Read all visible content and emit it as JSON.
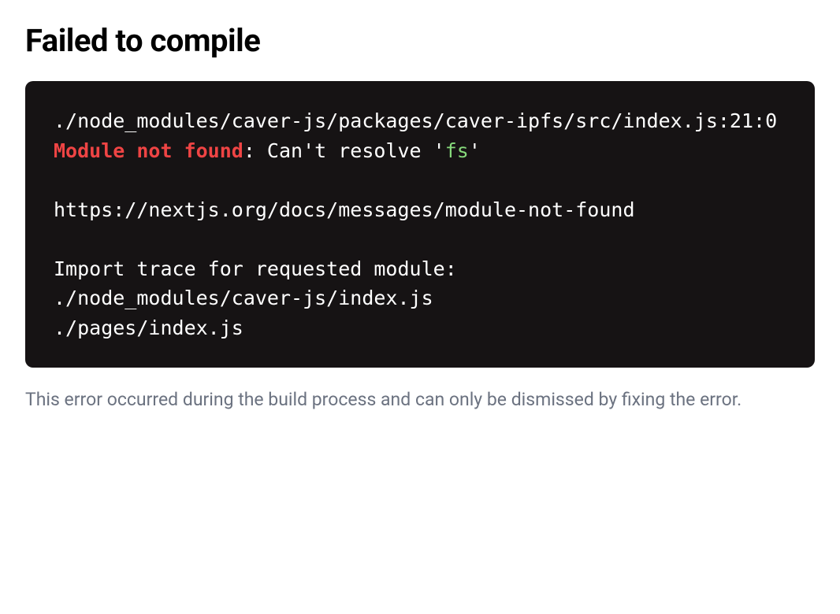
{
  "title": "Failed to compile",
  "code": {
    "file_location": "./node_modules/caver-js/packages/caver-ipfs/src/index.js:21:0",
    "error_label": "Module not found",
    "error_message_prefix": ": Can't resolve '",
    "error_module": "fs",
    "error_message_suffix": "'",
    "docs_url": "https://nextjs.org/docs/messages/module-not-found",
    "trace_header": "Import trace for requested module:",
    "trace_line_1": "./node_modules/caver-js/index.js",
    "trace_line_2": "./pages/index.js"
  },
  "footer": "This error occurred during the build process and can only be dismissed by fixing the error."
}
